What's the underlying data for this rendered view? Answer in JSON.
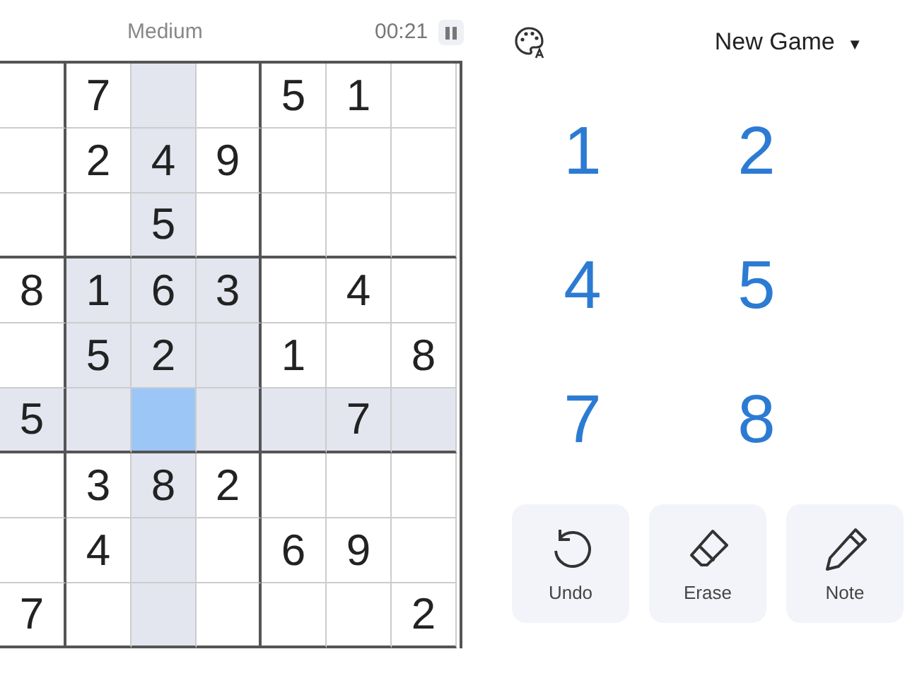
{
  "header": {
    "difficulty": "Medium",
    "timer": "00:21"
  },
  "new_game": {
    "label": "New Game",
    "caret": "▼"
  },
  "grid": {
    "rows": [
      [
        {
          "highlighted": false,
          "selected": false
        },
        {
          "value": "7",
          "highlighted": false,
          "selected": false
        },
        {
          "highlighted": true,
          "selected": false
        },
        {
          "highlighted": false,
          "selected": false
        },
        {
          "value": "5",
          "highlighted": false,
          "selected": false
        },
        {
          "value": "1",
          "highlighted": false,
          "selected": false
        },
        {
          "highlighted": false,
          "selected": false
        }
      ],
      [
        {
          "highlighted": false,
          "selected": false
        },
        {
          "value": "2",
          "highlighted": false,
          "selected": false
        },
        {
          "value": "4",
          "highlighted": true,
          "selected": false
        },
        {
          "value": "9",
          "highlighted": false,
          "selected": false
        },
        {
          "highlighted": false,
          "selected": false
        },
        {
          "highlighted": false,
          "selected": false
        },
        {
          "highlighted": false,
          "selected": false
        }
      ],
      [
        {
          "highlighted": false,
          "selected": false
        },
        {
          "highlighted": false,
          "selected": false
        },
        {
          "value": "5",
          "highlighted": true,
          "selected": false
        },
        {
          "highlighted": false,
          "selected": false
        },
        {
          "highlighted": false,
          "selected": false
        },
        {
          "highlighted": false,
          "selected": false
        },
        {
          "highlighted": false,
          "selected": false
        }
      ],
      [
        {
          "value": "8",
          "highlighted": false,
          "selected": false
        },
        {
          "value": "1",
          "highlighted": true,
          "selected": false
        },
        {
          "value": "6",
          "highlighted": true,
          "selected": false
        },
        {
          "value": "3",
          "highlighted": true,
          "selected": false
        },
        {
          "highlighted": false,
          "selected": false
        },
        {
          "value": "4",
          "highlighted": false,
          "selected": false
        },
        {
          "highlighted": false,
          "selected": false
        }
      ],
      [
        {
          "highlighted": false,
          "selected": false
        },
        {
          "value": "5",
          "highlighted": true,
          "selected": false
        },
        {
          "value": "2",
          "highlighted": true,
          "selected": false
        },
        {
          "highlighted": true,
          "selected": false
        },
        {
          "value": "1",
          "highlighted": false,
          "selected": false
        },
        {
          "highlighted": false,
          "selected": false
        },
        {
          "value": "8",
          "highlighted": false,
          "selected": false
        }
      ],
      [
        {
          "value": "5",
          "highlighted": true,
          "selected": false
        },
        {
          "highlighted": true,
          "selected": false
        },
        {
          "highlighted": false,
          "selected": true
        },
        {
          "highlighted": true,
          "selected": false
        },
        {
          "highlighted": true,
          "selected": false
        },
        {
          "value": "7",
          "highlighted": true,
          "selected": false
        },
        {
          "highlighted": true,
          "selected": false
        }
      ],
      [
        {
          "highlighted": false,
          "selected": false
        },
        {
          "value": "3",
          "highlighted": false,
          "selected": false
        },
        {
          "value": "8",
          "highlighted": true,
          "selected": false
        },
        {
          "value": "2",
          "highlighted": false,
          "selected": false
        },
        {
          "highlighted": false,
          "selected": false
        },
        {
          "highlighted": false,
          "selected": false
        },
        {
          "highlighted": false,
          "selected": false
        }
      ],
      [
        {
          "highlighted": false,
          "selected": false
        },
        {
          "value": "4",
          "highlighted": false,
          "selected": false
        },
        {
          "highlighted": true,
          "selected": false
        },
        {
          "highlighted": false,
          "selected": false
        },
        {
          "value": "6",
          "highlighted": false,
          "selected": false
        },
        {
          "value": "9",
          "highlighted": false,
          "selected": false
        },
        {
          "highlighted": false,
          "selected": false
        }
      ],
      [
        {
          "value": "7",
          "highlighted": false,
          "selected": false
        },
        {
          "highlighted": false,
          "selected": false
        },
        {
          "highlighted": true,
          "selected": false
        },
        {
          "highlighted": false,
          "selected": false
        },
        {
          "highlighted": false,
          "selected": false
        },
        {
          "highlighted": false,
          "selected": false
        },
        {
          "value": "2",
          "highlighted": false,
          "selected": false
        }
      ]
    ]
  },
  "number_pad": [
    "1",
    "2",
    "4",
    "5",
    "7",
    "8"
  ],
  "tools": [
    {
      "kind": "undo",
      "label": "Undo"
    },
    {
      "kind": "erase",
      "label": "Erase"
    },
    {
      "kind": "note",
      "label": "Note"
    }
  ]
}
